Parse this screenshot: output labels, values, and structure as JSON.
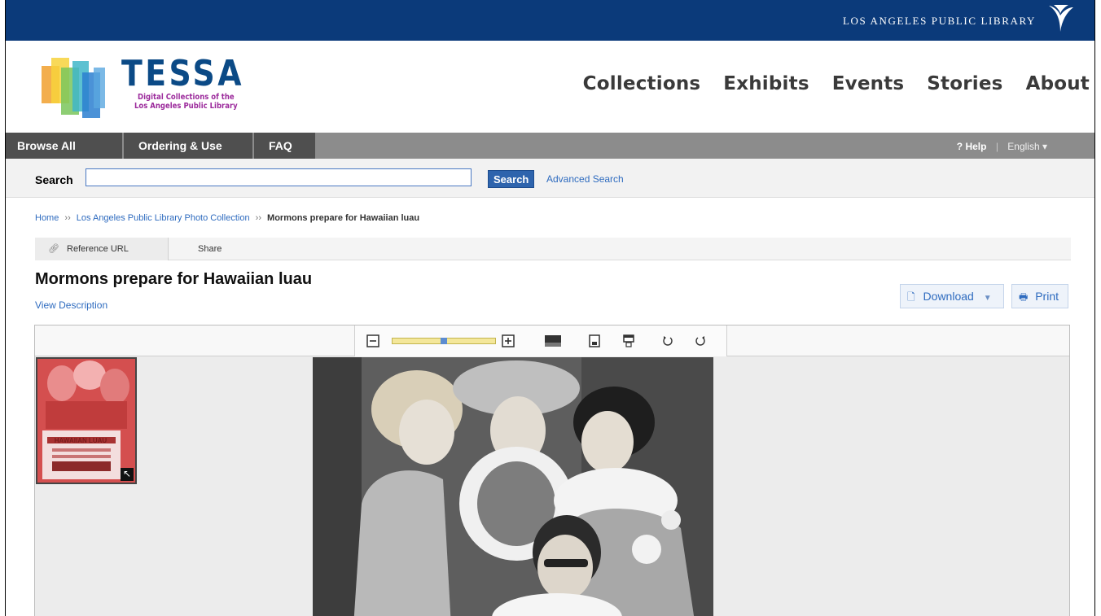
{
  "topbar": {
    "library_name": "LOS ANGELES PUBLIC LIBRARY"
  },
  "logo": {
    "title": "TESSA",
    "subtitle_line1": "Digital Collections of the",
    "subtitle_line2": "Los Angeles Public Library"
  },
  "main_nav": [
    "Collections",
    "Exhibits",
    "Events",
    "Stories",
    "About"
  ],
  "menu": {
    "items": [
      "Browse All",
      "Ordering & Use",
      "FAQ"
    ],
    "help": "? Help",
    "separator": "|",
    "language": "English ▾"
  },
  "search": {
    "label": "Search",
    "value": "",
    "button": "Search",
    "advanced": "Advanced Search"
  },
  "breadcrumb": {
    "home": "Home",
    "collection": "Los Angeles Public Library Photo Collection",
    "current": "Mormons prepare for Hawaiian luau",
    "separator": "››"
  },
  "tabs": {
    "reference": "Reference URL",
    "share": "Share"
  },
  "item": {
    "title": "Mormons prepare for Hawaiian luau",
    "view_description": "View Description",
    "download": "Download",
    "print": "Print"
  },
  "viewer": {
    "zoom_level": 0.5,
    "thumbnail_caption": "HAWAIIAN LUAU"
  },
  "colors": {
    "topbar": "#0b3a7a",
    "menubar": "#8c8c8c",
    "link": "#2e6bbf",
    "accent": "#2e64ad"
  }
}
